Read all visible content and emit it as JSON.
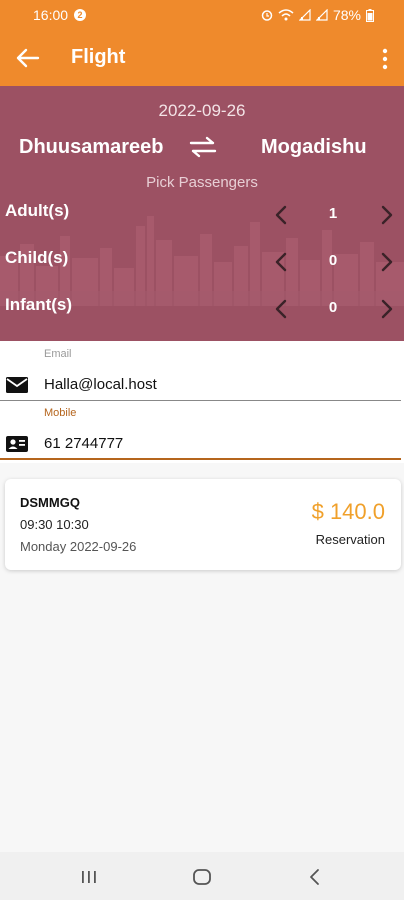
{
  "status": {
    "time": "16:00",
    "notification_badge": "2",
    "battery": "78%",
    "icons": [
      "alarm-icon",
      "wifi-icon",
      "signal-icon",
      "signal-icon",
      "battery-icon"
    ]
  },
  "app_bar": {
    "title": "Flight",
    "back_icon": "arrow-left-icon",
    "menu_icon": "more-vertical-icon"
  },
  "trip": {
    "date": "2022-09-26",
    "from": "Dhuusamareeb",
    "to": "Mogadishu",
    "swap_icon": "swap-arrows-icon",
    "pick_label": "Pick Passengers",
    "passengers": [
      {
        "label": "Adult(s)",
        "count": "1"
      },
      {
        "label": "Child(s)",
        "count": "0"
      },
      {
        "label": "Infant(s)",
        "count": "0"
      }
    ]
  },
  "contact": {
    "email": {
      "label": "Email",
      "value": "Halla@local.host",
      "icon": "mail-icon"
    },
    "mobile": {
      "label": "Mobile",
      "value": "61 2744777",
      "icon": "contact-card-icon"
    }
  },
  "flight_card": {
    "code": "DSMMGQ",
    "times": "09:30 10:30",
    "date": "Monday 2022-09-26",
    "price": "$ 140.0",
    "status": "Reservation"
  },
  "colors": {
    "primary": "#ef8a2c",
    "hero": "#9c5163",
    "price": "#f0a02a",
    "field_active": "#b5651d"
  }
}
